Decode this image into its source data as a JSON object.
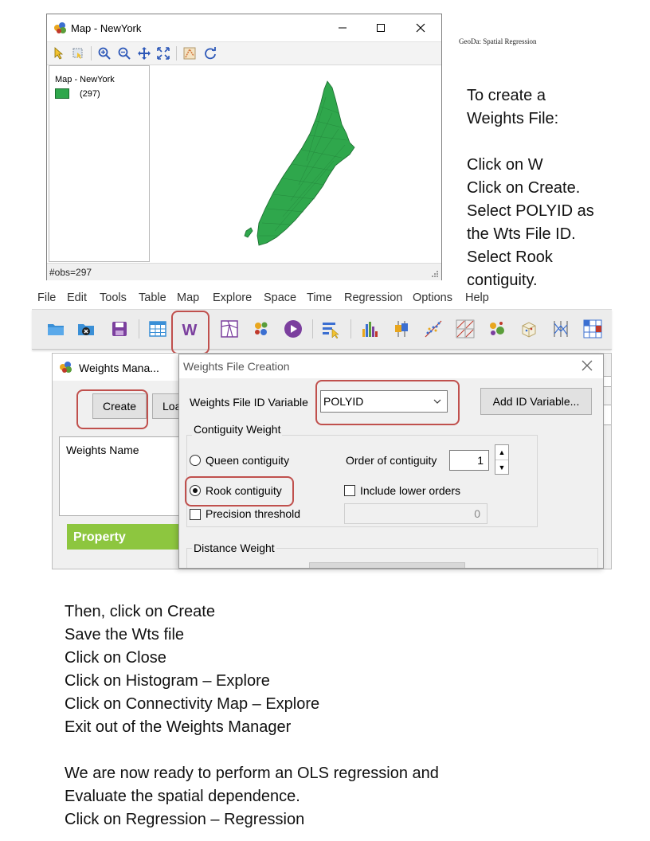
{
  "map_window": {
    "title": "Map - NewYork",
    "legend_title": "Map - NewYork",
    "legend_count": "(297)",
    "status": "#obs=297",
    "fill_color": "#2fa74c"
  },
  "caption": "GeoDa: Spatial Regression",
  "instructions_right": [
    "To create a",
    "Weights File:",
    "",
    "Click on W",
    "Click on Create.",
    "Select POLYID as",
    "the Wts File ID.",
    "Select Rook",
    "contiguity."
  ],
  "menu": [
    "File",
    "Edit",
    "Tools",
    "Table",
    "Map",
    "Explore",
    "Space",
    "Time",
    "Regression",
    "Options",
    "Help"
  ],
  "weights_manager": {
    "title": "Weights Mana...",
    "create_label": "Create",
    "load_label": "Loa",
    "list_header": "Weights Name",
    "property_label": "Property"
  },
  "weights_dialog": {
    "title": "Weights File Creation",
    "id_variable_label": "Weights File ID Variable",
    "id_variable_value": "POLYID",
    "add_id_label": "Add ID Variable...",
    "contiguity_legend": "Contiguity Weight",
    "queen_label": "Queen contiguity",
    "rook_label": "Rook contiguity",
    "order_label": "Order of contiguity",
    "order_value": "1",
    "include_lower_label": "Include lower orders",
    "precision_label": "Precision threshold",
    "precision_value": "0",
    "distance_legend": "Distance Weight",
    "selected_contiguity": "rook"
  },
  "instructions_bottom": [
    "Then, click on Create",
    "Save the Wts file",
    "Click on Close",
    "Click on Histogram – Explore",
    "Click on Connectivity Map – Explore",
    "Exit out of the Weights Manager",
    "",
    "We are now ready to perform an OLS regression and",
    "Evaluate the spatial dependence.",
    "Click on Regression – Regression"
  ],
  "colors": {
    "highlight": "#c0504d",
    "property_bar": "#8dc63f",
    "w_icon": "#7b3f9e"
  }
}
